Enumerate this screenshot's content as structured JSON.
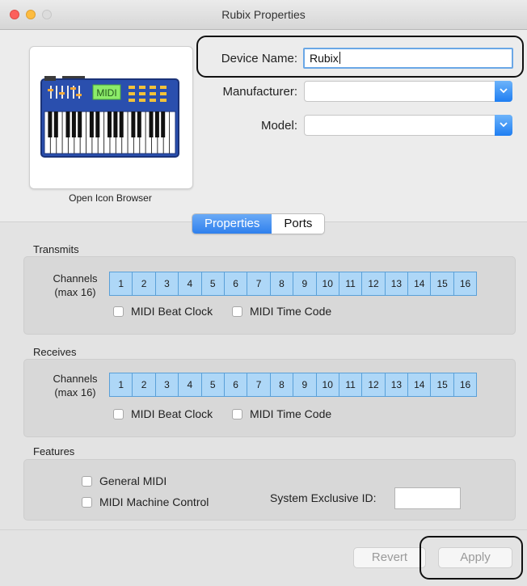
{
  "window": {
    "title": "Rubix Properties"
  },
  "icon_browser": {
    "label": "Open Icon Browser",
    "midi_display": "MIDI"
  },
  "device": {
    "device_name_label": "Device Name:",
    "device_name_value": "Rubix",
    "manufacturer_label": "Manufacturer:",
    "manufacturer_value": "",
    "model_label": "Model:",
    "model_value": ""
  },
  "tabs": {
    "properties": "Properties",
    "ports": "Ports",
    "selected": "Properties"
  },
  "transmits": {
    "section_label": "Transmits",
    "channels_label": "Channels",
    "max_label": "(max 16)",
    "channels": [
      "1",
      "2",
      "3",
      "4",
      "5",
      "6",
      "7",
      "8",
      "9",
      "10",
      "11",
      "12",
      "13",
      "14",
      "15",
      "16"
    ],
    "beat_clock_label": "MIDI Beat Clock",
    "beat_clock_checked": false,
    "time_code_label": "MIDI Time Code",
    "time_code_checked": false
  },
  "receives": {
    "section_label": "Receives",
    "channels_label": "Channels",
    "max_label": "(max 16)",
    "channels": [
      "1",
      "2",
      "3",
      "4",
      "5",
      "6",
      "7",
      "8",
      "9",
      "10",
      "11",
      "12",
      "13",
      "14",
      "15",
      "16"
    ],
    "beat_clock_label": "MIDI Beat Clock",
    "beat_clock_checked": false,
    "time_code_label": "MIDI Time Code",
    "time_code_checked": false
  },
  "features": {
    "section_label": "Features",
    "general_midi_label": "General MIDI",
    "general_midi_checked": false,
    "machine_control_label": "MIDI Machine Control",
    "machine_control_checked": false,
    "sysex_label": "System Exclusive ID:",
    "sysex_value": ""
  },
  "buttons": {
    "revert": "Revert",
    "apply": "Apply"
  },
  "colors": {
    "accent_blue": "#2f80ed",
    "channel_fill": "#aed7f7",
    "channel_border": "#5aa0d8",
    "close_light": "#fc605c",
    "minimize_light": "#fdbc40"
  }
}
